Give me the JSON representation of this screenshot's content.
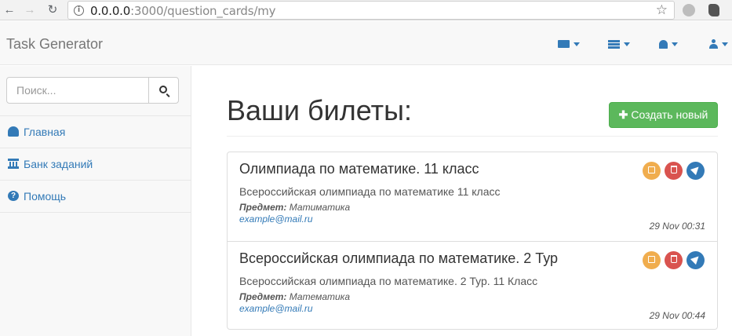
{
  "browser": {
    "url_host": "0.0.0.0",
    "url_path": ":3000/question_cards/my",
    "back_icon": "←",
    "forward_icon": "→",
    "reload_icon": "↻",
    "info_icon": "i",
    "star_icon": "☆"
  },
  "navbar": {
    "brand": "Task Generator",
    "menus": [
      "envelope-icon",
      "tasks-icon",
      "bell-icon",
      "user-icon"
    ]
  },
  "sidebar": {
    "search": {
      "placeholder": "Поиск...",
      "value": ""
    },
    "items": [
      {
        "label": "Главная",
        "icon": "dashboard-icon"
      },
      {
        "label": "Банк заданий",
        "icon": "bank-icon"
      },
      {
        "label": "Помощь",
        "icon": "question-circle-icon"
      }
    ]
  },
  "main": {
    "title": "Ваши билеты:",
    "create_button": "Создать новый",
    "create_plus": "✚",
    "cards": [
      {
        "title": "Олимпиада по математике. 11 класс",
        "description": "Всероссийская олимпиада по математике 11 класс",
        "subject_label": "Предмет:",
        "subject": "Матиматика",
        "email": "example@mail.ru",
        "date": "29 Nov 00:31"
      },
      {
        "title": "Всероссийская олимпиада по математике. 2 Тур",
        "description": "Всероссийская олимпиада по математике. 2 Тур. 11 Класс",
        "subject_label": "Предмет:",
        "subject": "Математика",
        "email": "example@mail.ru",
        "date": "29 Nov 00:44"
      }
    ]
  },
  "colors": {
    "link": "#337ab7",
    "success": "#5cb85c",
    "warning": "#f0ad4e",
    "danger": "#d9534f"
  }
}
